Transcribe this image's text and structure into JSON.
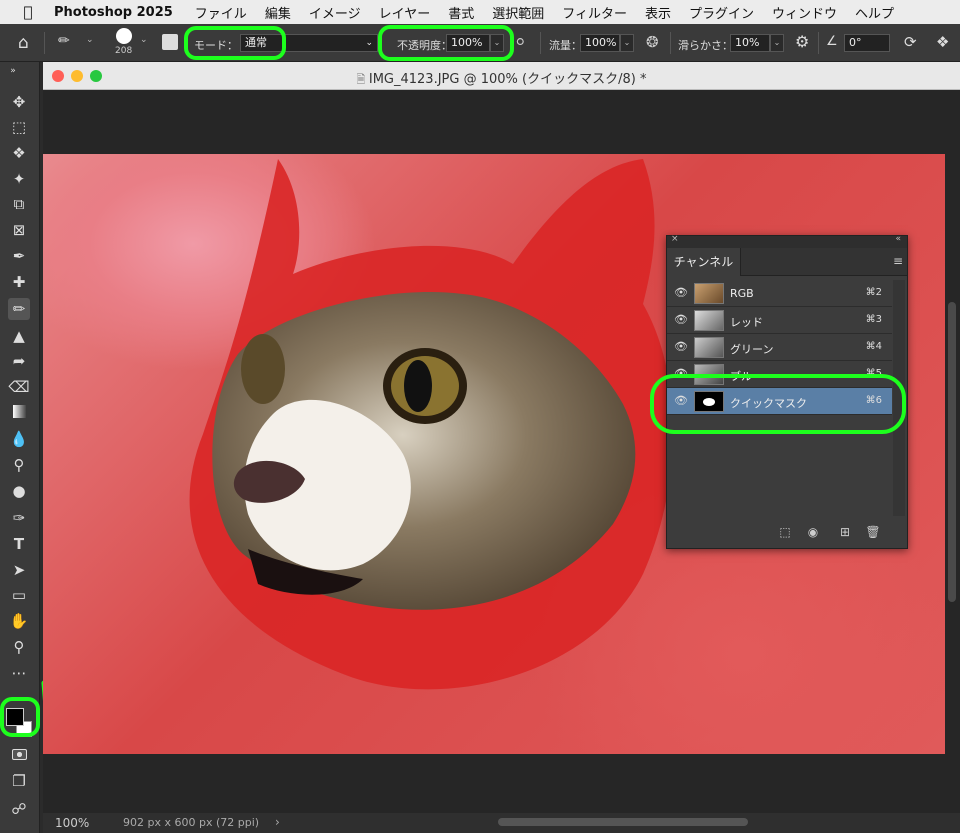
{
  "menubar": {
    "app": "Photoshop 2025",
    "items": [
      "ファイル",
      "編集",
      "イメージ",
      "レイヤー",
      "書式",
      "選択範囲",
      "フィルター",
      "表示",
      "プラグイン",
      "ウィンドウ",
      "ヘルプ"
    ]
  },
  "options": {
    "brush_size": "208",
    "mode_label": "モード：",
    "mode_value": "通常",
    "opacity_label": "不透明度：",
    "opacity_value": "100%",
    "flow_label": "流量：",
    "flow_value": "100%",
    "smoothing_label": "滑らかさ：",
    "smoothing_value": "10%",
    "angle_value": "0°"
  },
  "document": {
    "title": "IMG_4123.JPG @ 100% (クイックマスク/8) *",
    "zoom": "100%",
    "info": "902 px x 600 px (72 ppi)"
  },
  "channels_panel": {
    "tab": "チャンネル",
    "channels": [
      {
        "name": "RGB",
        "shortcut": "⌘2",
        "selected": false
      },
      {
        "name": "レッド",
        "shortcut": "⌘3",
        "selected": false
      },
      {
        "name": "グリーン",
        "shortcut": "⌘4",
        "selected": false
      },
      {
        "name": "ブルー",
        "shortcut": "⌘5",
        "selected": false
      },
      {
        "name": "クイックマスク",
        "shortcut": "⌘6",
        "selected": true
      }
    ]
  },
  "colors": {
    "highlight": "#1dff1d",
    "selection": "#5a7fa6",
    "mask_overlay": "#e05050"
  }
}
